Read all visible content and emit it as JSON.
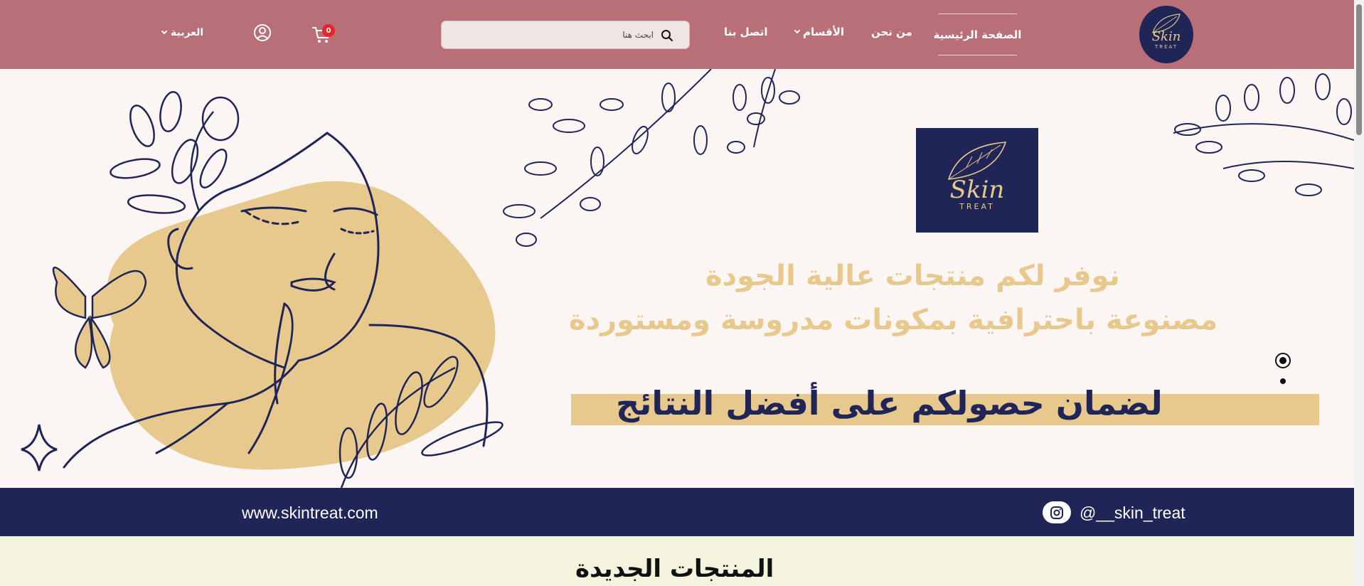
{
  "header": {
    "logo": {
      "script": "Skin",
      "small": "TREAT"
    },
    "nav": {
      "home": "الصفحة الرئيسية",
      "about": "من نحن",
      "sections": "الأقسام",
      "contact": "اتصل بنا"
    },
    "search": {
      "placeholder": "ابحث هنا",
      "icon": "search-icon"
    },
    "cart": {
      "count": "0",
      "icon": "cart-icon"
    },
    "user": {
      "icon": "user-icon"
    },
    "language": "العربية"
  },
  "hero": {
    "brand": {
      "script": "Skin",
      "small": "TREAT"
    },
    "line1": "نوفر لكم منتجات عالية الجودة",
    "line2": "مصنوعة باحترافية بمكونات مدروسة ومستوردة",
    "line3": "لضمان حصولكم على أفضل النتائج",
    "slider": {
      "total": 2,
      "active": 1
    }
  },
  "band": {
    "website": "www.skintreat.com",
    "instagram": "@__skin_treat",
    "icon": "instagram-icon"
  },
  "section": {
    "title": "المنتجات الجديدة"
  },
  "colors": {
    "header": "#b86f78",
    "navy": "#1f2556",
    "gold": "#e8c98d",
    "hero_bg": "#fbf6f4",
    "section_bg": "#f4f3dd",
    "badge": "#e4252d"
  }
}
